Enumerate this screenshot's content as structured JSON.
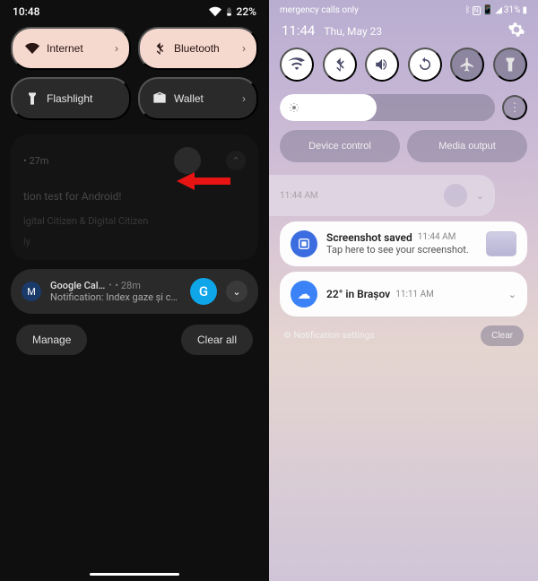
{
  "left": {
    "status": {
      "time": "10:48",
      "battery": "22%"
    },
    "qs": {
      "internet": "Internet",
      "bluetooth": "Bluetooth",
      "flashlight": "Flashlight",
      "wallet": "Wallet"
    },
    "dimmed": {
      "time": "• 27m",
      "line1": "tion test for Android!",
      "line2": "igital Citizen & Digital Citizen",
      "line3": "ly"
    },
    "notif": {
      "app": "Google Cal…",
      "dot": "•",
      "time": "• 28m",
      "body": "Notification: Index gaze și cure…",
      "avatar_letter": "G"
    },
    "actions": {
      "manage": "Manage",
      "clear_all": "Clear all"
    }
  },
  "right": {
    "status": {
      "carrier": "mergency calls only",
      "battery": "31%"
    },
    "header": {
      "time": "11:44",
      "date": "Thu, May 23"
    },
    "controls": {
      "device": "Device control",
      "media": "Media output"
    },
    "dim_notif": {
      "time": "11:44 AM"
    },
    "screenshot": {
      "title": "Screenshot saved",
      "time": "11:44 AM",
      "body": "Tap here to see your screenshot."
    },
    "weather": {
      "title": "22° in Brașov",
      "time": "11:11 AM"
    },
    "bottom": {
      "settings": "Notification settings",
      "clear": "Clear"
    }
  }
}
